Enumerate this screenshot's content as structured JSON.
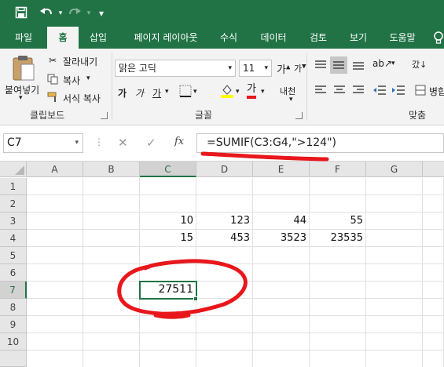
{
  "quick_access": {
    "save_icon": "save-icon",
    "undo_icon": "undo-icon",
    "redo_icon": "redo-icon",
    "customize": "▾"
  },
  "tabs": [
    "파일",
    "홈",
    "삽입",
    "페이지 레이아웃",
    "수식",
    "데이터",
    "검토",
    "보기",
    "도움말"
  ],
  "active_tab": "홈",
  "ribbon": {
    "clipboard": {
      "paste_label": "붙여넣기",
      "cut_label": "잘라내기",
      "copy_label": "복사",
      "format_painter_label": "서식 복사",
      "group_label": "클립보드"
    },
    "font": {
      "font_name": "맑은 고딕",
      "font_size": "11",
      "bold": "가",
      "italic": "가",
      "underline": "가",
      "font_color_label": "가",
      "phonetic": "내천",
      "group_label": "글꼴"
    },
    "alignment": {
      "group_label": "맞춤",
      "wrap_label": "갔↓",
      "merge_label": "병합"
    }
  },
  "formula_bar": {
    "name_box": "C7",
    "cancel": "✕",
    "enter": "✓",
    "fx": "fx",
    "formula": "=SUMIF(C3:G4,\">124\")"
  },
  "grid": {
    "columns": [
      "A",
      "B",
      "C",
      "D",
      "E",
      "F",
      "G"
    ],
    "rows": [
      "1",
      "2",
      "3",
      "4",
      "5",
      "6",
      "7",
      "8",
      "9",
      "10"
    ],
    "selected_cell": "C7",
    "cells": {
      "C3": "10",
      "D3": "123",
      "E3": "44",
      "F3": "55",
      "C4": "15",
      "D4": "453",
      "E4": "3523",
      "F4": "23535",
      "C7": "27511"
    }
  },
  "colors": {
    "excel_green": "#217346",
    "annotation_red": "#e8171c"
  }
}
